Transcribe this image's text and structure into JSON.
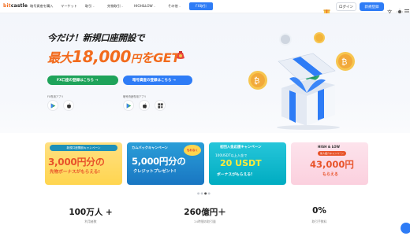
{
  "brand": {
    "logo_prefix": "bit",
    "logo_suffix": "castle"
  },
  "nav": {
    "items": [
      {
        "label": "暗号資産を購入",
        "has_menu": false
      },
      {
        "label": "マーケット",
        "has_menu": false
      },
      {
        "label": "取引",
        "has_menu": true
      },
      {
        "label": "先物取引",
        "has_menu": true
      },
      {
        "label": "HIGH&LOW",
        "has_menu": true
      },
      {
        "label": "その他",
        "has_menu": true
      }
    ],
    "fx_button": "FX取引",
    "login": "ログイン",
    "register": "新規登録"
  },
  "hero": {
    "line1": "今だけ！新規口座開設で",
    "line2_prefix": "最大",
    "line2_amount": "18,000",
    "line2_unit": "円",
    "line2_suffix": "をGET",
    "cta_fx": "FX口座の登録はこちら →",
    "cta_crypto": "暗号資産の登録はこちら →",
    "fx_app_label": "FX専用アプリ",
    "crypto_app_label": "暗号資産専用アプリ"
  },
  "banners": [
    {
      "tag": "新規口座開設キャンペーン",
      "main": "3,000円分の",
      "sub": "先物ボーナスがもらえる!"
    },
    {
      "tag": "カムバックキャンペーン",
      "main": "5,000円分の",
      "sub": "クレジットプレゼント!",
      "badge": "もれなく"
    },
    {
      "tag": "初回入金応援キャンペーン",
      "main": "20 USDT",
      "pre": "100USDT以上入金で",
      "sub": "ボーナスがもらえる!"
    },
    {
      "tag": "HIGH & LOW",
      "pre": "新人紹介キャンペーン",
      "main": "43,000円",
      "sub": "もらえる"
    }
  ],
  "stats": [
    {
      "value": "100万人 +",
      "label": "利用者数"
    },
    {
      "value": "260億円＋",
      "label": "24時間の取引量"
    },
    {
      "value": "0%",
      "label": "取引手数料"
    }
  ],
  "colors": {
    "accent": "#2e7cf6",
    "brand": "#f26b1d",
    "green": "#1ea35a"
  }
}
